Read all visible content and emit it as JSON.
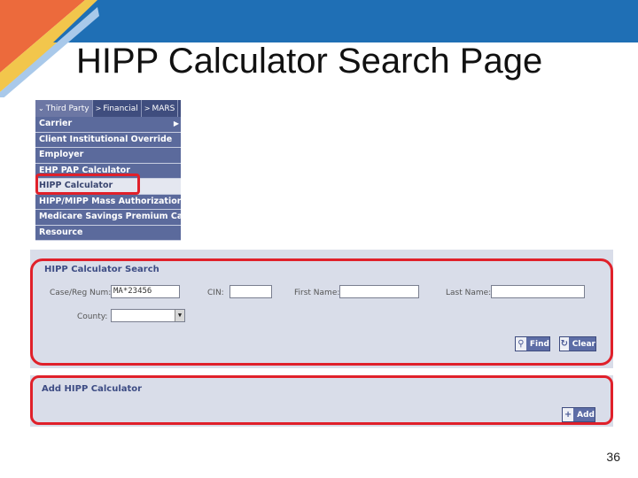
{
  "slide": {
    "title": "HIPP Calculator Search Page",
    "page_number": "36"
  },
  "menu": {
    "tabs": [
      {
        "label": "Third Party",
        "icon": "chevron-down-icon"
      },
      {
        "label": "Financial",
        "icon": "chevron-right-icon"
      },
      {
        "label": "MARS",
        "icon": "chevron-right-icon"
      }
    ],
    "items": [
      {
        "label": "Carrier"
      },
      {
        "label": "Client Institutional Override"
      },
      {
        "label": "Employer"
      },
      {
        "label": "EHP PAP Calculator"
      },
      {
        "label": "HIPP Calculator"
      },
      {
        "label": "HIPP/MIPP Mass Authorization"
      },
      {
        "label": "Medicare Savings Premium Cap"
      },
      {
        "label": "Resource"
      }
    ]
  },
  "search": {
    "title": "HIPP Calculator Search",
    "case_reg_label": "Case/Reg Num:",
    "case_reg_value": "MA*23456",
    "cin_label": "CIN:",
    "cin_value": "",
    "first_name_label": "First Name:",
    "first_name_value": "",
    "last_name_label": "Last Name:",
    "last_name_value": "",
    "county_label": "County:",
    "county_value": "",
    "find_label": "Find",
    "clear_label": "Clear"
  },
  "add": {
    "title": "Add HIPP Calculator",
    "add_label": "Add"
  },
  "colors": {
    "accent_blue": "#1f6fb5",
    "highlight_red": "#e0202a",
    "menu_bg": "#5b6a9c",
    "panel_bg": "#d9dde9"
  }
}
